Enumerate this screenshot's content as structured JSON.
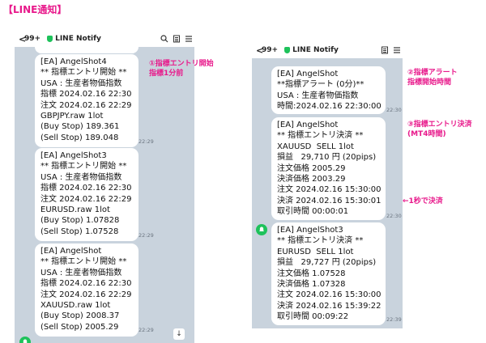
{
  "title": "【LINE通知】",
  "header": {
    "back": "<",
    "count": "99+",
    "name": "LINE Notify",
    "search_icon": "search-icon",
    "note_icon": "note-icon",
    "menu_icon": "menu-icon"
  },
  "left": {
    "messages": [
      {
        "text": "[EA] AngelShot4\n** 指標エントリ開始 **\nUSA : 生産者物価指数\n指標 2024.02.16 22:30\n注文 2024.02.16 22:29\nGBPJPY.raw 1lot\n(Buy Stop) 189.361\n(Sell Stop) 189.048",
        "time": "22:29"
      },
      {
        "text": "[EA] AngelShot3\n** 指標エントリ開始 **\nUSA : 生産者物価指数\n指標 2024.02.16 22:30\n注文 2024.02.16 22:29\nEURUSD.raw 1lot\n(Buy Stop) 1.07828\n(Sell Stop) 1.07528",
        "time": "22:29"
      },
      {
        "text": "[EA] AngelShot\n** 指標エントリ開始 **\nUSA : 生産者物価指数\n指標 2024.02.16 22:30\n注文 2024.02.16 22:29\nXAUUSD.raw 1lot\n(Buy Stop) 2008.37\n(Sell Stop) 2005.29",
        "time": "22:29"
      }
    ]
  },
  "right": {
    "messages": [
      {
        "text": "[EA] AngelShot\n**指標アラート (0分)**\nUSA : 生産者物価指数\n時間:2024.02.16 22:30:00",
        "time": "22:30"
      },
      {
        "text": "[EA] AngelShot\n** 指標エントリ決済 **\nXAUUSD  SELL 1lot\n損益   29,710 円 (20pips)\n注文価格 2005.29\n決済価格 2003.29\n注文 2024.02.16 15:30:00\n決済 2024.02.16 15:30:01\n取引時間 00:00:01",
        "time": "22:30"
      },
      {
        "text": "[EA] AngelShot3\n** 指標エントリ決済 **\nEURUSD  SELL 1lot\n損益   29,727 円 (20pips)\n注文価格 1.07528\n決済価格 1.07328\n注文 2024.02.16 15:30:00\n決済 2024.02.16 15:39:22\n取引時間 00:09:22",
        "time": "22:39"
      }
    ]
  },
  "annotations": {
    "a1": "①指標エントリ開始\n指標1分前",
    "a2": "②指標アラート\n指標開始時間",
    "a3": "③指標エントリ決済\n(MT4時間)",
    "a4": "←1秒で決済"
  },
  "colors": {
    "accent": "#e8198b",
    "green": "#1ec25b",
    "chat_bg": "#c9d3dd",
    "bubble": "#ffffff"
  }
}
